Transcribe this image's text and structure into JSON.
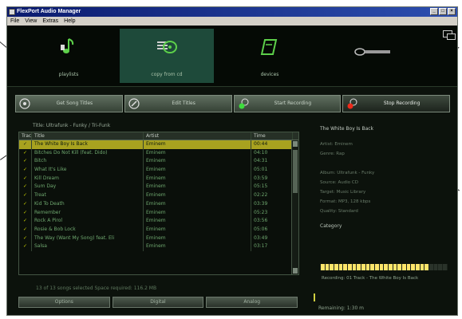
{
  "window": {
    "title": "FlexPort Audio Manager",
    "controls": [
      "_",
      "□",
      "×"
    ]
  },
  "menu": [
    "File",
    "View",
    "Extras",
    "Help"
  ],
  "nav": {
    "items": [
      {
        "label": "playlists",
        "icon": "music-note-icon",
        "color": "#5dd04a"
      },
      {
        "label": "copy from cd",
        "icon": "cd-copy-icon",
        "color": "#5dd04a"
      },
      {
        "label": "devices",
        "icon": "device-icon",
        "color": "#5dd04a"
      },
      {
        "label": "",
        "icon": "brand-logo-icon",
        "color": "#bfbfbf"
      }
    ],
    "active_index": 1
  },
  "toolbar": {
    "buttons": [
      {
        "label": "Get Song Titles",
        "icon": "cd-info-icon"
      },
      {
        "label": "Edit Titles",
        "icon": "edit-titles-icon"
      },
      {
        "label": "Start Recording",
        "icon": "start-record-icon"
      },
      {
        "label": "Stop Recording",
        "icon": "stop-record-icon"
      }
    ]
  },
  "album": {
    "line": "Title: Ultrafunk - Funky / Tri-Funk"
  },
  "tracks": {
    "columns": [
      "Track",
      "Title",
      "Artist",
      "Time"
    ],
    "rows": [
      {
        "check": "✓",
        "title": "The White Boy Is Back",
        "artist": "Eminem",
        "time": "00:44"
      },
      {
        "check": "✓",
        "title": "Bitches Do Not Kill (feat. Dido)",
        "artist": "Eminem",
        "time": "04:10"
      },
      {
        "check": "✓",
        "title": "Bitch",
        "artist": "Eminem",
        "time": "04:31"
      },
      {
        "check": "✓",
        "title": "What It's Like",
        "artist": "Eminem",
        "time": "05:01"
      },
      {
        "check": "✓",
        "title": "Kill Dream",
        "artist": "Eminem",
        "time": "03:59"
      },
      {
        "check": "✓",
        "title": "Sum Day",
        "artist": "Eminem",
        "time": "05:15"
      },
      {
        "check": "✓",
        "title": "Treat",
        "artist": "Eminem",
        "time": "02:22"
      },
      {
        "check": "✓",
        "title": "Kid To Death",
        "artist": "Eminem",
        "time": "03:39"
      },
      {
        "check": "✓",
        "title": "Remember",
        "artist": "Eminem",
        "time": "05:23"
      },
      {
        "check": "✓",
        "title": "Rock A Pirol",
        "artist": "Eminem",
        "time": "03:56"
      },
      {
        "check": "✓",
        "title": "Rosie & Bob Lock",
        "artist": "Eminem",
        "time": "05:06"
      },
      {
        "check": "✓",
        "title": "The Way (Want My Song) feat. Eli",
        "artist": "Eminem",
        "time": "03:49"
      },
      {
        "check": "✓",
        "title": "Salsa",
        "artist": "Eminem",
        "time": "03:17"
      }
    ],
    "selected_index": 0
  },
  "status": {
    "summary": "13 of 13 songs selected  Space required: 116.2 MB"
  },
  "bottom_buttons": [
    "Options",
    "Digital",
    "Analog"
  ],
  "details": {
    "title": "The White Boy Is Back",
    "lines": [
      "Artist: Eminem",
      "Genre: Rap",
      "Album: Ultrafunk - Funky",
      "Source: Audio CD",
      "Target: Music Library",
      "Format: MP3, 128 kbps",
      "Quality: Standard"
    ],
    "category": "Category",
    "progress_fraction": 0.86,
    "now_recording": "Recording: 01 Track - The White Boy Is Back",
    "remaining": "Remaining: 1:30 m"
  }
}
